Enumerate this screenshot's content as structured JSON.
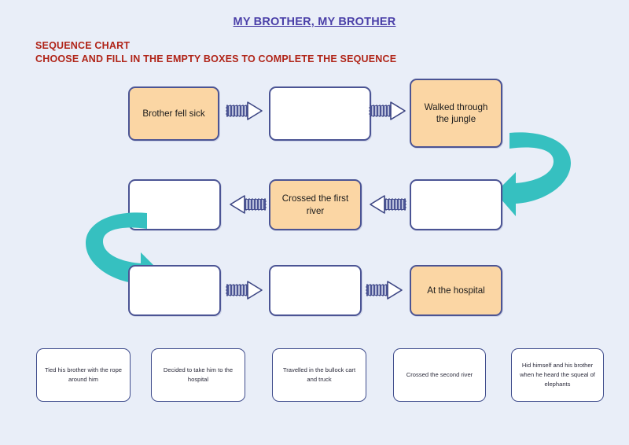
{
  "page": {
    "title": "MY BROTHER, MY BROTHER",
    "subtitle_line1": "SEQUENCE CHART",
    "subtitle_line2": "CHOOSE AND FILL IN THE EMPTY BOXES TO COMPLETE THE SEQUENCE",
    "background_color": "#e9eef8",
    "title_color": "#4a3fa8",
    "subtitle_color": "#b02418"
  },
  "colors": {
    "box_border": "#4b5494",
    "box_filled": "#fbd6a4",
    "box_empty": "#ffffff",
    "arrow_shaft": "#4b5494",
    "arrow_head": "#ffffff",
    "curve_arrow": "#36c0c0",
    "option_border": "#3f4c8c"
  },
  "flow": {
    "rows": [
      {
        "row": 1,
        "direction": "left-to-right",
        "nodes": [
          {
            "id": "r1c1",
            "label": "Brother fell sick",
            "state": "filled"
          },
          {
            "id": "r1c2",
            "label": "",
            "state": "empty"
          },
          {
            "id": "r1c3",
            "label": "Walked through the jungle",
            "state": "filled"
          }
        ]
      },
      {
        "row": 2,
        "direction": "right-to-left",
        "nodes": [
          {
            "id": "r2c1",
            "label": "",
            "state": "empty"
          },
          {
            "id": "r2c2",
            "label": "Crossed the first river",
            "state": "filled"
          },
          {
            "id": "r2c3",
            "label": "",
            "state": "empty"
          }
        ]
      },
      {
        "row": 3,
        "direction": "left-to-right",
        "nodes": [
          {
            "id": "r3c1",
            "label": "",
            "state": "empty"
          },
          {
            "id": "r3c2",
            "label": "",
            "state": "empty"
          },
          {
            "id": "r3c3",
            "label": "At the hospital",
            "state": "filled"
          }
        ]
      }
    ],
    "connectors": {
      "row1_arrow1": "block-arrow-right-icon",
      "row1_arrow2": "block-arrow-right-icon",
      "row2_arrow1": "block-arrow-left-icon",
      "row2_arrow2": "block-arrow-left-icon",
      "row3_arrow1": "block-arrow-right-icon",
      "row3_arrow2": "block-arrow-right-icon",
      "right_wrap": "curved-arrow-down-left-icon",
      "left_wrap": "curved-arrow-down-right-icon"
    }
  },
  "option_bank": {
    "options": [
      {
        "id": "opt1",
        "label": "Tied his brother with the rope around him"
      },
      {
        "id": "opt2",
        "label": "Decided to take him to the hospital"
      },
      {
        "id": "opt3",
        "label": "Travelled in the bullock cart and truck"
      },
      {
        "id": "opt4",
        "label": "Crossed the second river"
      },
      {
        "id": "opt5",
        "label": "Hid himself and his brother when he heard the squeal of elephants"
      }
    ]
  }
}
